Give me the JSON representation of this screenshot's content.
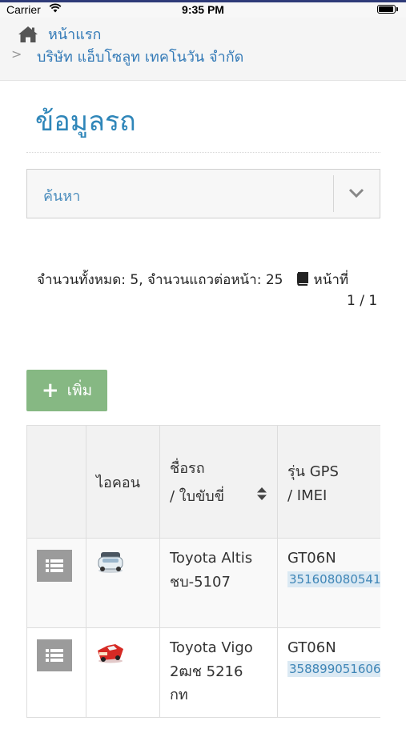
{
  "status_bar": {
    "carrier": "Carrier",
    "time": "9:35 PM"
  },
  "breadcrumb": {
    "home_label": "หน้าแรก",
    "separator": ">",
    "company_label": "บริษัท แอ็บโซลูท เทคโนวัน จำกัด"
  },
  "page": {
    "title": "ข้อมูลรถ"
  },
  "search": {
    "label": "ค้นหา"
  },
  "summary": {
    "text": "จำนวนทั้งหมด: 5, จำนวนแถวต่อหน้า: 25",
    "page_label": "หน้าที่",
    "page_value": "1 / 1"
  },
  "actions": {
    "add_label": "เพิ่ม"
  },
  "table": {
    "headers": {
      "icon": "ไอคอน",
      "name_line1": "ชื่อรถ",
      "name_line2": "/ ใบขับขี่",
      "gps_line1": "รุ่น GPS",
      "gps_line2": "/ IMEI"
    },
    "rows": [
      {
        "name": "Toyota Altis",
        "plate": "ชบ-5107",
        "gps_model": "GT06N",
        "imei": "351608080541",
        "icon": "white-car-icon"
      },
      {
        "name": "Toyota Vigo",
        "plate": "2ฒช 5216 กท",
        "gps_model": "GT06N",
        "imei": "358899051606",
        "icon": "red-pickup-icon"
      }
    ]
  },
  "colors": {
    "link": "#337ab7",
    "title": "#2f86b9",
    "add_button": "#86b883",
    "row_button": "#9b9b9b",
    "imei_bg": "#dbe9f3"
  }
}
